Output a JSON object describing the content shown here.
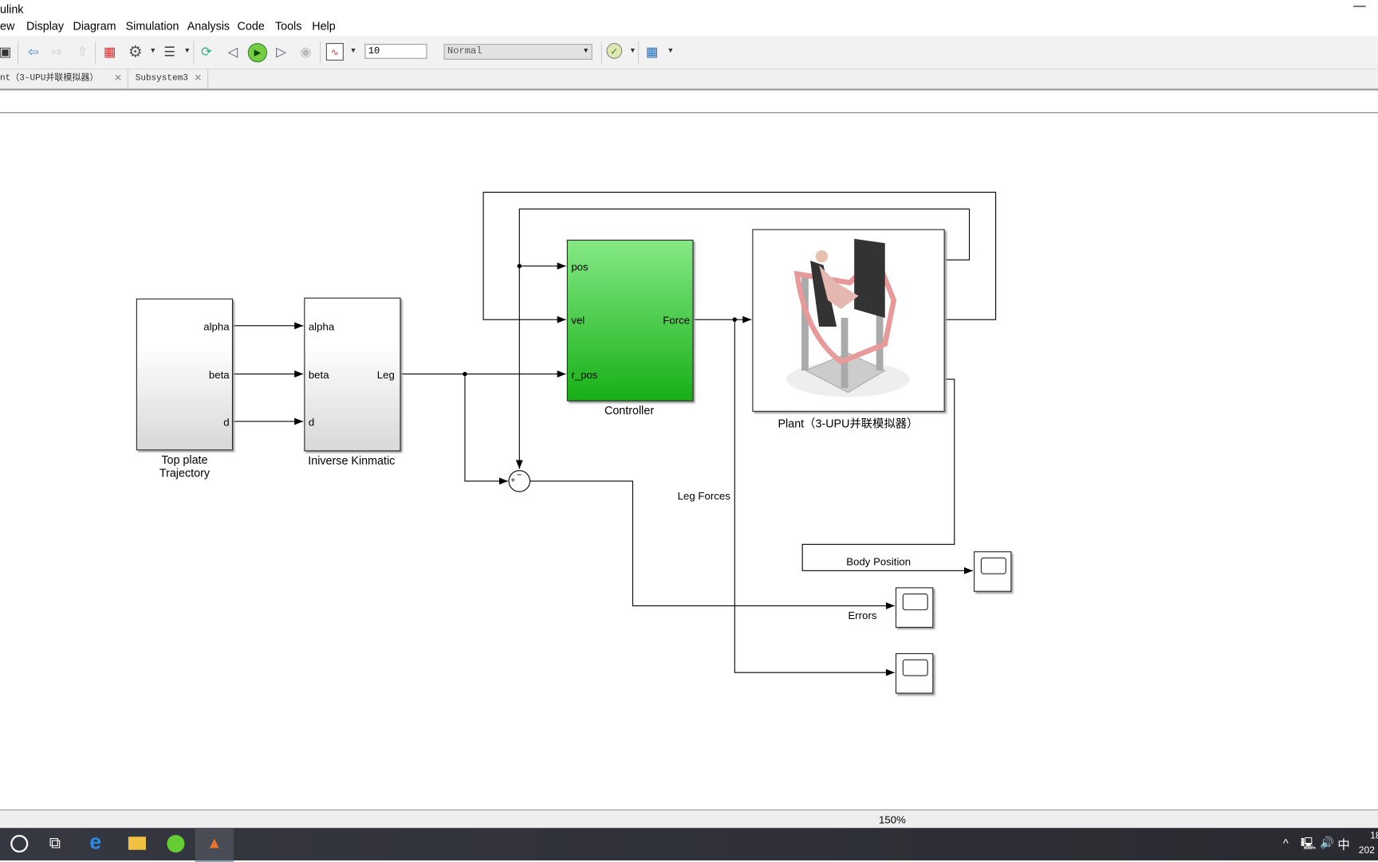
{
  "window": {
    "title": "ulink"
  },
  "menu": [
    "ew",
    "Display",
    "Diagram",
    "Simulation",
    "Analysis",
    "Code",
    "Tools",
    "Help"
  ],
  "toolbar": {
    "stop_time": "10",
    "sim_mode": "Normal",
    "icons": [
      "save-icon",
      "back-icon",
      "forward-icon",
      "up-icon",
      "library-browser-icon",
      "settings-gear-icon",
      "model-explorer-icon",
      "update-icon",
      "step-back-icon",
      "run-icon",
      "step-forward-icon",
      "stop-icon",
      "scope-icon",
      "check-icon",
      "grid-icon"
    ]
  },
  "tabs": [
    {
      "label": "nt（3-UPU并联模拟器）"
    },
    {
      "label": "Subsystem3"
    }
  ],
  "blocks": {
    "trajectory": {
      "label1": "Top plate",
      "label2": "Trajectory",
      "ports": [
        "alpha",
        "beta",
        "d"
      ]
    },
    "ik": {
      "label": "Iniverse Kinmatic",
      "inputs": [
        "alpha",
        "beta",
        "d"
      ],
      "output": "Leg"
    },
    "controller": {
      "label": "Controller",
      "inputs": [
        "pos",
        "vel",
        "r_pos"
      ],
      "output": "Force",
      "color": "#3cc83c"
    },
    "plant": {
      "label": "Plant（3-UPU并联模拟器）"
    },
    "sum": {
      "minus": "−",
      "plus": "+"
    }
  },
  "signals": {
    "leg_forces": "Leg Forces",
    "body_position": "Body Position",
    "errors": "Errors"
  },
  "status": {
    "zoom": "150%"
  },
  "taskbar": {
    "time": "18",
    "date": "202",
    "ime": "中"
  }
}
